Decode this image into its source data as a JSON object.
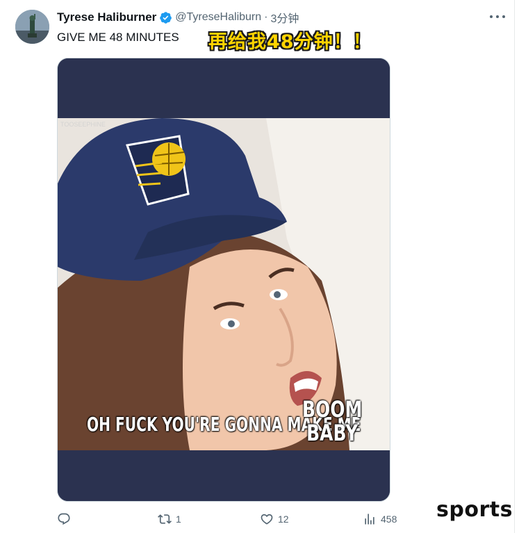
{
  "tweet": {
    "display_name": "Tyrese Haliburner",
    "handle": "@TyreseHaliburn",
    "separator": "·",
    "time": "3分钟",
    "text": "GIVE ME 48 MINUTES",
    "verified": true
  },
  "overlay_caption": "再给我48分钟！！",
  "media": {
    "watermark": "TOOSEEPHINE",
    "meme_line": "OH FUCK YOU'RE GONNA MAKE ME",
    "meme_boom": "BOOM",
    "meme_baby": "BABY",
    "colors": {
      "band": "#2b3250",
      "cap": "#2b3a6b",
      "logo": "#f0c419"
    }
  },
  "actions": {
    "reply_count": "",
    "retweet_count": "1",
    "like_count": "12",
    "views_count": "458",
    "icons": [
      "reply-icon",
      "retweet-icon",
      "like-icon",
      "views-icon"
    ]
  },
  "brand": "sports",
  "colors": {
    "text_primary": "#0f1419",
    "text_secondary": "#536471",
    "verified_blue": "#1d9bf0",
    "caption_yellow": "#ffd400"
  }
}
